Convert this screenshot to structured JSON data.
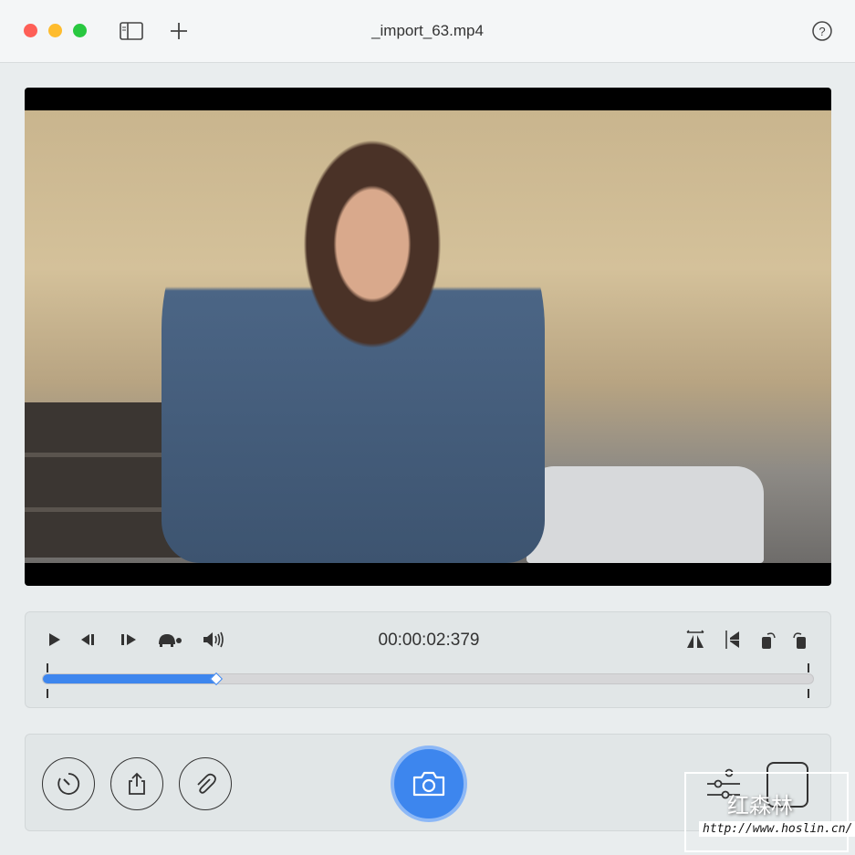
{
  "window": {
    "title": "_import_63.mp4",
    "traffic_lights": {
      "close": "#fe5f57",
      "minimize": "#febc2e",
      "zoom": "#28c840"
    }
  },
  "toolbar": {
    "icons": [
      "sidebar-icon",
      "plus-icon",
      "help-icon"
    ]
  },
  "player": {
    "timecode": "00:00:02:379",
    "progress_percent": 22.6,
    "accent": "#3d86ee",
    "controls": [
      "play-icon",
      "step-back-icon",
      "step-forward-icon",
      "slow-motion-turtle-icon",
      "volume-icon"
    ],
    "transform_controls": [
      "flip-horizontal-icon",
      "flip-vertical-icon",
      "rotate-left-icon",
      "rotate-right-icon"
    ]
  },
  "actions": {
    "left": [
      "timer-icon",
      "share-icon",
      "attachment-icon"
    ],
    "center": "camera-icon",
    "right": [
      "adjustments-icon",
      "crop-icon"
    ]
  },
  "watermark": {
    "text": "红森林",
    "url": "http://www.hoslin.cn/"
  }
}
